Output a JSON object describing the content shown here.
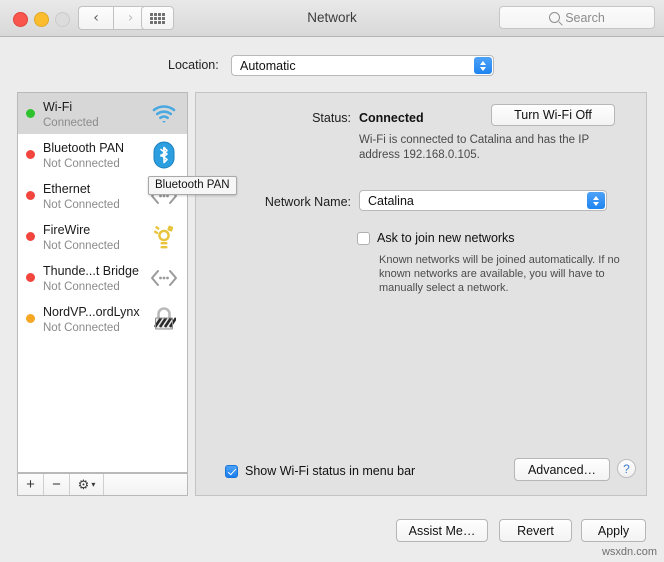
{
  "window": {
    "title": "Network",
    "traffic_lights": [
      "close",
      "minimize",
      "zoom"
    ],
    "nav_back_icon": "chevron-left-icon",
    "nav_forward_icon": "chevron-right-icon",
    "grid_icon": "show-all-grid-icon"
  },
  "search": {
    "placeholder": "Search",
    "icon": "search-icon"
  },
  "location": {
    "label": "Location:",
    "value": "Automatic"
  },
  "sidebar": {
    "services": [
      {
        "name": "Wi-Fi",
        "status": "Connected",
        "dot": "green",
        "icon": "wifi-icon",
        "selected": true
      },
      {
        "name": "Bluetooth PAN",
        "status": "Not Connected",
        "dot": "red",
        "icon": "bluetooth-icon",
        "selected": false
      },
      {
        "name": "Ethernet",
        "status": "Not Connected",
        "dot": "red",
        "icon": "ethernet-icon",
        "selected": false
      },
      {
        "name": "FireWire",
        "status": "Not Connected",
        "dot": "red",
        "icon": "firewire-icon",
        "selected": false
      },
      {
        "name": "Thunde...t Bridge",
        "status": "Not Connected",
        "dot": "red",
        "icon": "thunderbolt-icon",
        "selected": false
      },
      {
        "name": "NordVP...ordLynx",
        "status": "Not Connected",
        "dot": "orange",
        "icon": "vpn-lock-icon",
        "selected": false
      }
    ],
    "footer": {
      "add_label": "+",
      "remove_label": "−",
      "gear_icon": "gear-icon",
      "gear_chevron_icon": "chevron-down-icon"
    }
  },
  "tooltip": {
    "text": "Bluetooth PAN"
  },
  "panel": {
    "status_label": "Status:",
    "status_value": "Connected",
    "turn_off_button": "Turn Wi-Fi Off",
    "status_detail": "Wi-Fi is connected to Catalina and has the IP address 192.168.0.105.",
    "network_name_label": "Network Name:",
    "network_name_value": "Catalina",
    "ask_join_label": "Ask to join new networks",
    "ask_join_checked": false,
    "ask_join_help": "Known networks will be joined automatically. If no known networks are available, you will have to manually select a network.",
    "show_status_label": "Show Wi-Fi status in menu bar",
    "show_status_checked": true,
    "advanced_button": "Advanced…",
    "help_button": "?"
  },
  "footer": {
    "assist_button": "Assist Me…",
    "revert_button": "Revert",
    "apply_button": "Apply"
  },
  "watermark": "wsxdn.com",
  "colors": {
    "accent_blue": "#1f84f0",
    "status_green": "#2fc22f",
    "status_red": "#f2453d",
    "status_orange": "#f5a623",
    "window_bg": "#ececec",
    "panel_bg": "#e2e2e2",
    "selected_row": "#d7d7d7"
  }
}
